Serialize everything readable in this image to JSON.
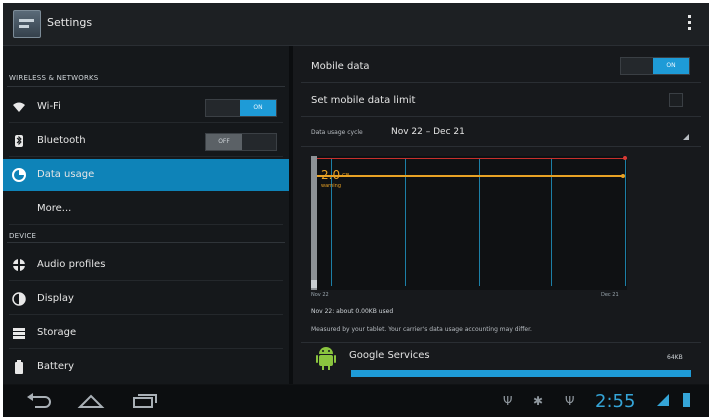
{
  "actionbar": {
    "title": "Settings",
    "overflow_icon": "more-vert-icon"
  },
  "sidebar": {
    "sections": [
      {
        "header": "WIRELESS & NETWORKS"
      },
      {
        "header": "DEVICE"
      }
    ],
    "items": [
      {
        "label": "Wi-Fi",
        "icon": "wifi-icon",
        "toggle": "ON"
      },
      {
        "label": "Bluetooth",
        "icon": "bluetooth-icon",
        "toggle": "OFF"
      },
      {
        "label": "Data usage",
        "icon": "data-usage-icon",
        "selected": true
      },
      {
        "label": "More...",
        "icon": ""
      },
      {
        "label": "Audio profiles",
        "icon": "audio-profiles-icon"
      },
      {
        "label": "Display",
        "icon": "display-icon"
      },
      {
        "label": "Storage",
        "icon": "storage-icon"
      },
      {
        "label": "Battery",
        "icon": "battery-icon"
      }
    ]
  },
  "detail": {
    "mobile_data_label": "Mobile data",
    "mobile_data_toggle": "ON",
    "limit_label": "Set mobile data limit",
    "cycle_label": "Data usage cycle",
    "cycle_value": "Nov 22 – Dec 21",
    "chart": {
      "limit_value": "2.0",
      "limit_unit": "GB",
      "warning_label": "warning",
      "tick_start": "Nov 22",
      "tick_end": "Dec 21"
    },
    "usage_summary": "Nov 22: about 0.00KB used",
    "disclaimer": "Measured by your tablet. Your carrier's data usage accounting may differ.",
    "apps": [
      {
        "name": "Google Services",
        "size": "64KB",
        "progress": 1.0
      }
    ]
  },
  "navbar": {
    "back_icon": "back-icon",
    "home_icon": "home-icon",
    "recents_icon": "recent-apps-icon",
    "time": "2:55"
  },
  "colors": {
    "accent": "#1e9bd7",
    "warning": "#e8a225",
    "limit": "#c7302c"
  }
}
